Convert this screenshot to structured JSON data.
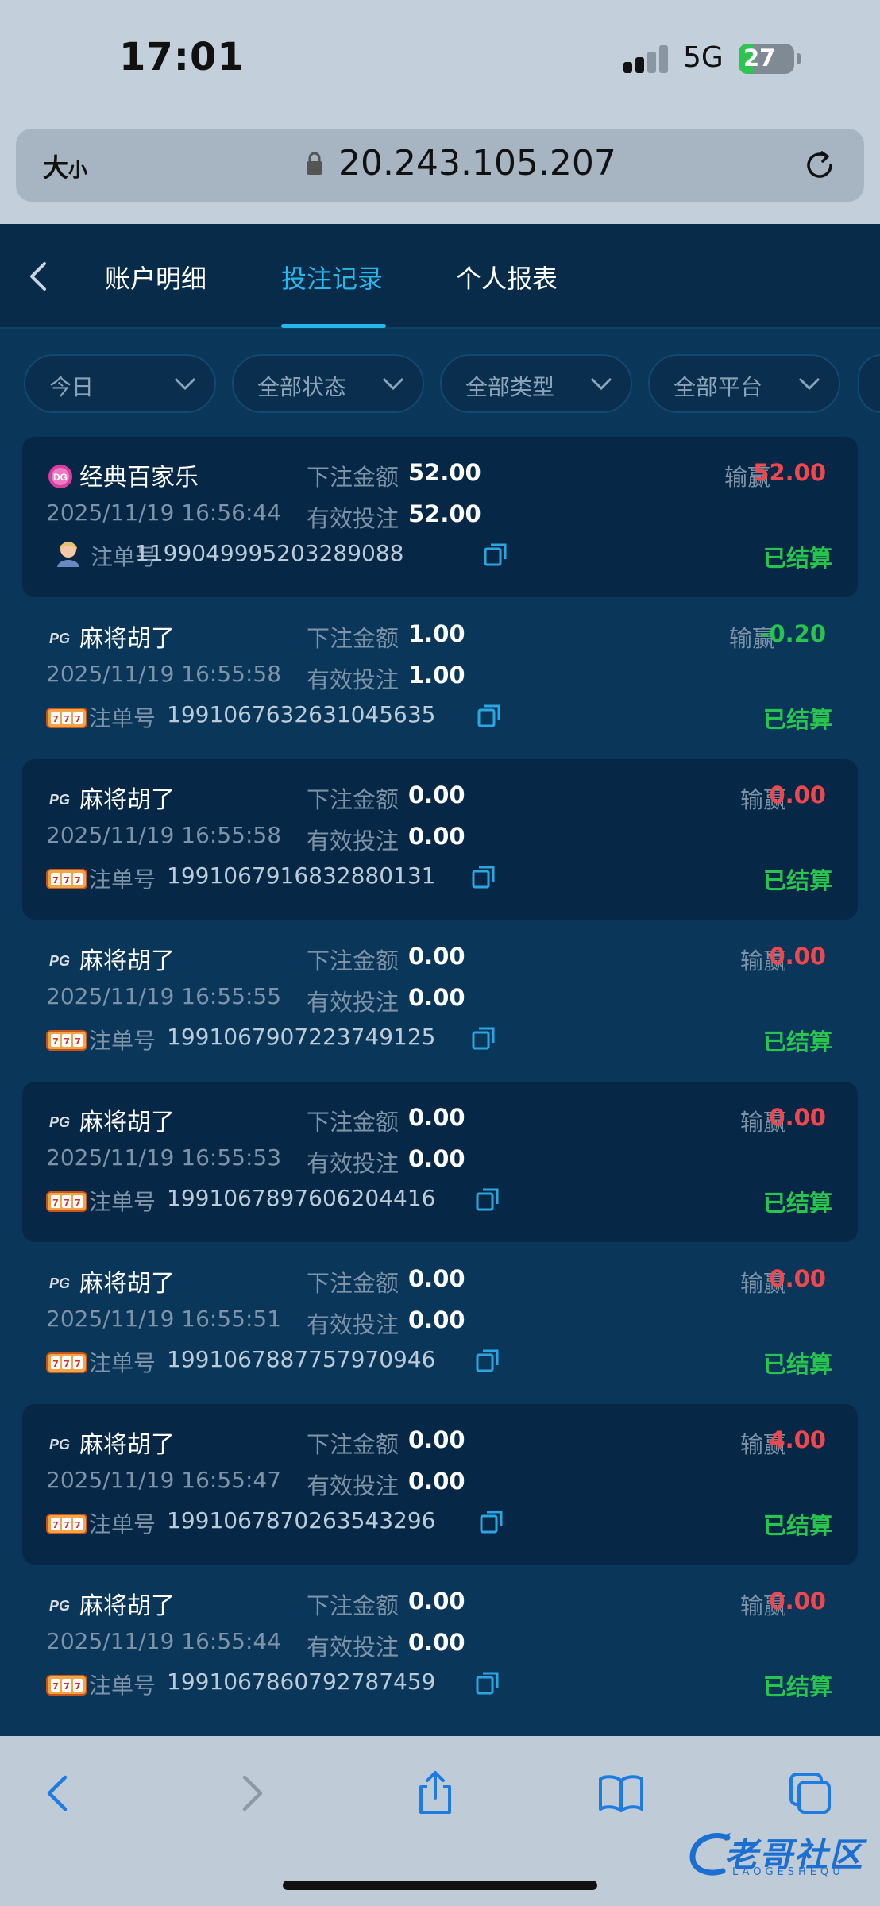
{
  "status_bar": {
    "time": "17:01",
    "network": "5G",
    "battery": "27",
    "battery_level": 0.27
  },
  "browser": {
    "text_size_big": "大",
    "text_size_small": "小",
    "url": "20.243.105.207"
  },
  "header": {
    "tabs": [
      {
        "label": "账户明细"
      },
      {
        "label": "投注记录"
      },
      {
        "label": "个人报表"
      }
    ],
    "active_tab": 1
  },
  "filters": [
    {
      "label": "今日"
    },
    {
      "label": "全部状态"
    },
    {
      "label": "全部类型"
    },
    {
      "label": "全部平台"
    }
  ],
  "labels": {
    "bet_amount": "下注金额",
    "valid_bet": "有效投注",
    "win_loss": "输赢",
    "order_no": "注单号"
  },
  "records": [
    {
      "game": "经典百家乐",
      "time": "2025/11/19 16:56:44",
      "bet_amount": "52.00",
      "valid_bet": "52.00",
      "win_loss": "52.00",
      "order_no": "1199049995203289088",
      "status": "已结算",
      "icon": "dg-logo-icon",
      "sub_icon": "dealer-avatar-icon",
      "win_color": "#f0474f"
    },
    {
      "game": "麻将胡了",
      "time": "2025/11/19 16:55:58",
      "bet_amount": "1.00",
      "valid_bet": "1.00",
      "win_loss": "-0.20",
      "order_no": "1991067632631045635",
      "status": "已结算",
      "icon": "pg-logo-icon",
      "sub_icon": "slot-machine-icon",
      "win_color": "#27c44e"
    },
    {
      "game": "麻将胡了",
      "time": "2025/11/19 16:55:58",
      "bet_amount": "0.00",
      "valid_bet": "0.00",
      "win_loss": "0.00",
      "order_no": "1991067916832880131",
      "status": "已结算",
      "icon": "pg-logo-icon",
      "sub_icon": "slot-machine-icon",
      "win_color": "#f0474f"
    },
    {
      "game": "麻将胡了",
      "time": "2025/11/19 16:55:55",
      "bet_amount": "0.00",
      "valid_bet": "0.00",
      "win_loss": "0.00",
      "order_no": "1991067907223749125",
      "status": "已结算",
      "icon": "pg-logo-icon",
      "sub_icon": "slot-machine-icon",
      "win_color": "#f0474f"
    },
    {
      "game": "麻将胡了",
      "time": "2025/11/19 16:55:53",
      "bet_amount": "0.00",
      "valid_bet": "0.00",
      "win_loss": "0.00",
      "order_no": "1991067897606204416",
      "status": "已结算",
      "icon": "pg-logo-icon",
      "sub_icon": "slot-machine-icon",
      "win_color": "#f0474f"
    },
    {
      "game": "麻将胡了",
      "time": "2025/11/19 16:55:51",
      "bet_amount": "0.00",
      "valid_bet": "0.00",
      "win_loss": "0.00",
      "order_no": "1991067887757970946",
      "status": "已结算",
      "icon": "pg-logo-icon",
      "sub_icon": "slot-machine-icon",
      "win_color": "#f0474f"
    },
    {
      "game": "麻将胡了",
      "time": "2025/11/19 16:55:47",
      "bet_amount": "0.00",
      "valid_bet": "0.00",
      "win_loss": "4.00",
      "order_no": "1991067870263543296",
      "status": "已结算",
      "icon": "pg-logo-icon",
      "sub_icon": "slot-machine-icon",
      "win_color": "#f0474f"
    },
    {
      "game": "麻将胡了",
      "time": "2025/11/19 16:55:44",
      "bet_amount": "0.00",
      "valid_bet": "0.00",
      "win_loss": "0.00",
      "order_no": "1991067860792787459",
      "status": "已结算",
      "icon": "pg-logo-icon",
      "sub_icon": "slot-machine-icon",
      "win_color": "#f0474f"
    }
  ],
  "watermark": {
    "text": "老哥社区",
    "sub": "LAOGESHEQU"
  },
  "colors": {
    "accent": "#26b8ea",
    "win_red": "#f0474f",
    "settled_green": "#27c44e",
    "background": "#0a3659"
  }
}
